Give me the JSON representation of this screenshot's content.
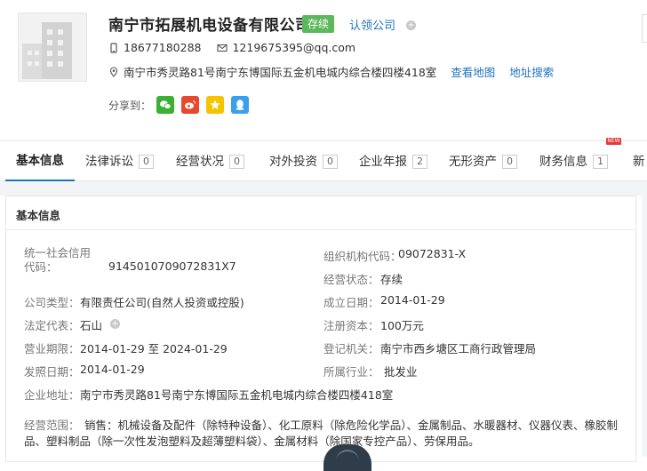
{
  "company": {
    "name": "南宁市拓展机电设备有限公司",
    "status_badge": "存续",
    "claim_label": "认领公司",
    "phone": "18677180288",
    "email": "1219675395@qq.com",
    "address": "南宁市秀灵路81号南宁东博国际五金机电城内综合楼四楼418室",
    "view_map": "查看地图",
    "address_search": "地址搜索",
    "share_label": "分享到："
  },
  "tabs": [
    {
      "label": "基本信息",
      "count": ""
    },
    {
      "label": "法律诉讼",
      "count": "0"
    },
    {
      "label": "经营状况",
      "count": "0"
    },
    {
      "label": "对外投资",
      "count": "0"
    },
    {
      "label": "企业年报",
      "count": "2"
    },
    {
      "label": "无形资产",
      "count": "0"
    },
    {
      "label": "财务信息",
      "count": "1"
    },
    {
      "label": "新",
      "count": ""
    }
  ],
  "new_badge": "NEW",
  "section": {
    "title": "基本信息",
    "fields": {
      "credit_code_label": "统一社会信用代码：",
      "credit_code_value": "9145010709072831X7",
      "org_code_label": "组织机构代码：",
      "org_code_value": "09072831-X",
      "op_status_label": "经营状态：",
      "op_status_value": "存续",
      "company_type_label": "公司类型：",
      "company_type_value": "有限责任公司(自然人投资或控股)",
      "founded_label": "成立日期：",
      "founded_value": "2014-01-29",
      "legal_rep_label": "法定代表：",
      "legal_rep_value": "石山",
      "reg_capital_label": "注册资本：",
      "reg_capital_value": "100万元",
      "term_label": "营业期限：",
      "term_value": "2014-01-29 至 2024-01-29",
      "reg_auth_label": "登记机关：",
      "reg_auth_value": "南宁市西乡塘区工商行政管理局",
      "issue_date_label": "发照日期：",
      "issue_date_value": "2014-01-29",
      "industry_label": "所属行业：",
      "industry_value": "批发业",
      "address_label": "企业地址：",
      "address_value": "南宁市秀灵路81号南宁东博国际五金机电城内综合楼四楼418室",
      "scope_label": "经营范围：",
      "scope_line1": "销售：机械设备及配件（除特种设备）、化工原料（除危险化学品）、金属制品、水暖器材、仪器仪表、橡胶制",
      "scope_line2": "品、塑料制品（除一次性发泡塑料及超薄塑料袋）、金属材料（除国家专控产品）、劳保用品。"
    }
  },
  "colors": {
    "accent": "#1e73be",
    "status_green": "#5cb85c",
    "wechat": "#3cb034",
    "weibo": "#e6492d",
    "qzone": "#f5c400",
    "qq": "#3b9ff0"
  }
}
